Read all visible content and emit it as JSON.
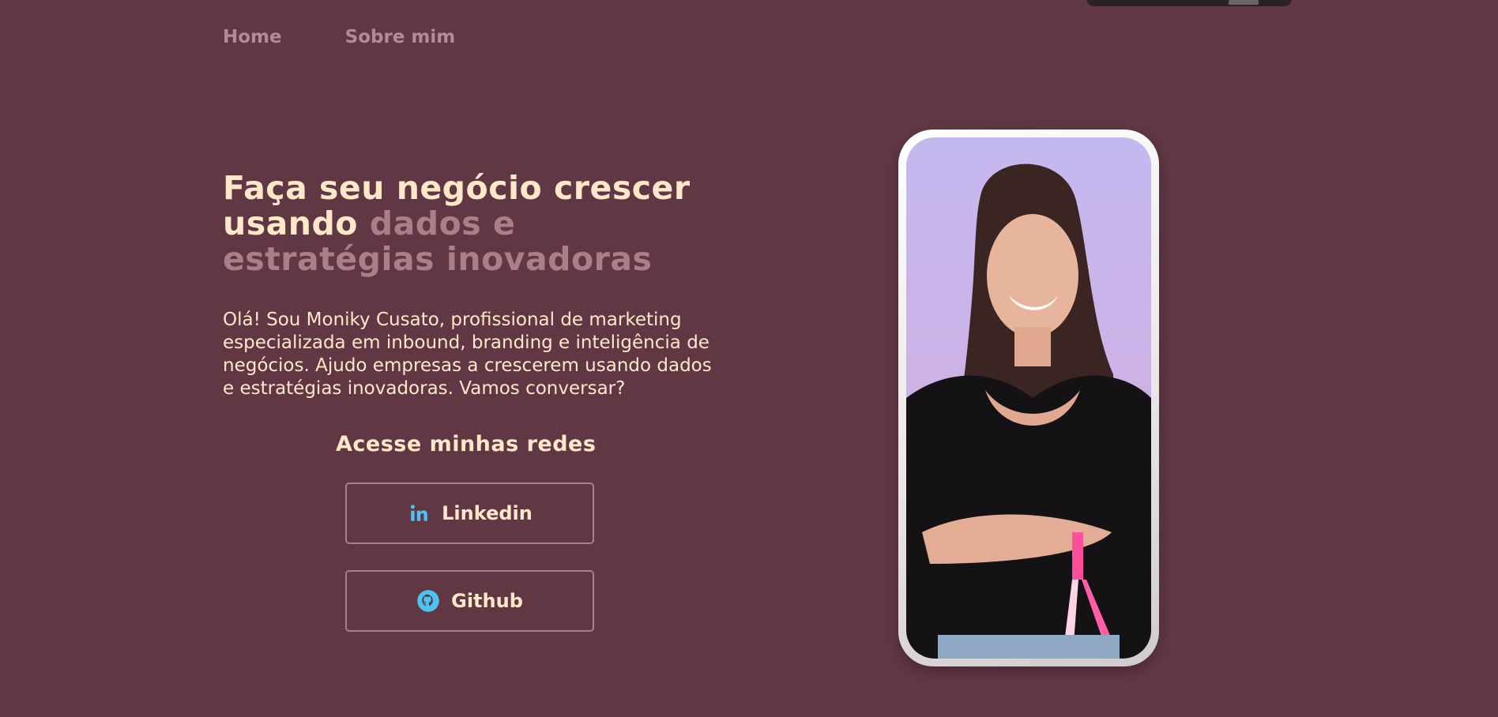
{
  "nav": {
    "items": [
      {
        "label": "Home"
      },
      {
        "label": "Sobre mim"
      }
    ]
  },
  "hero": {
    "headline_part1": "Faça seu negócio crescer usando ",
    "headline_accent": "dados e estratégias inovadoras",
    "intro": "Olá! Sou Moniky Cusato, profissional de marketing especializada em inbound, branding e inteligência de negócios. Ajudo empresas a crescerem usando dados e estratégias inovadoras. Vamos conversar?"
  },
  "social": {
    "title": "Acesse minhas redes",
    "linkedin_label": "Linkedin",
    "github_label": "Github"
  },
  "icons": {
    "linkedin": "linkedin-icon",
    "github": "github-icon"
  },
  "colors": {
    "background": "#613743",
    "text": "#fde9c9",
    "accent": "#ae7d8a",
    "icon": "#4cc3f0"
  }
}
